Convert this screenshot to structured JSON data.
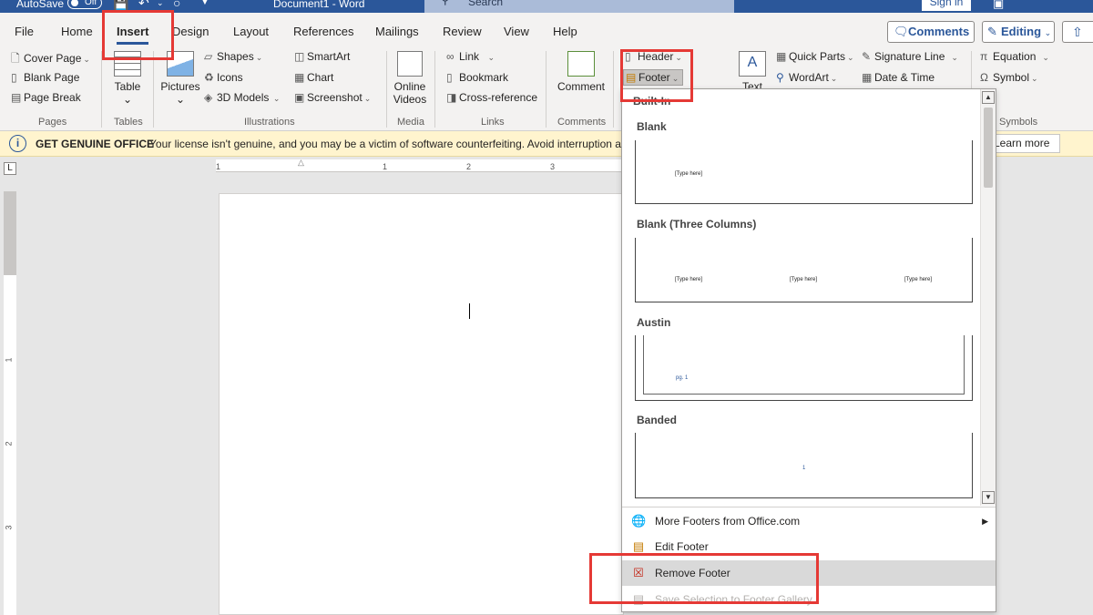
{
  "titlebar": {
    "autosave_label": "AutoSave",
    "autosave_state": "Off",
    "doc_title": "Document1  -  Word",
    "search_placeholder": "Search",
    "signin_label": "Sign in"
  },
  "tabs": [
    "File",
    "Home",
    "Insert",
    "Design",
    "Layout",
    "References",
    "Mailings",
    "Review",
    "View",
    "Help"
  ],
  "active_tab": "Insert",
  "top_buttons": {
    "comments": "Comments",
    "editing": "Editing"
  },
  "ribbon": {
    "pages": {
      "cover_page": "Cover Page",
      "blank_page": "Blank Page",
      "page_break": "Page Break",
      "group": "Pages"
    },
    "tables": {
      "table": "Table",
      "group": "Tables"
    },
    "illustrations": {
      "pictures": "Pictures",
      "shapes": "Shapes",
      "icons": "Icons",
      "models": "3D Models",
      "smartart": "SmartArt",
      "chart": "Chart",
      "screenshot": "Screenshot",
      "group": "Illustrations"
    },
    "media": {
      "online_videos_1": "Online",
      "online_videos_2": "Videos",
      "group": "Media"
    },
    "links": {
      "link": "Link",
      "bookmark": "Bookmark",
      "crossref": "Cross-reference",
      "group": "Links"
    },
    "comments": {
      "comment": "Comment",
      "group": "Comments"
    },
    "header_footer": {
      "header": "Header",
      "footer": "Footer"
    },
    "text": {
      "textbox": "Text",
      "quick_parts": "Quick Parts",
      "wordart": "WordArt",
      "signature_line": "Signature Line",
      "date_time": "Date & Time"
    },
    "symbols": {
      "equation": "Equation",
      "symbol": "Symbol",
      "group": "Symbols"
    }
  },
  "message_bar": {
    "title": "GET GENUINE OFFICE",
    "text": "Your license isn't genuine, and you may be a victim of software counterfeiting. Avoid interruption an",
    "learn_more": "Learn more"
  },
  "ruler": {
    "h_ticks": [
      "1",
      "1",
      "2",
      "3"
    ],
    "v_ticks": [
      "1",
      "1",
      "2",
      "3"
    ]
  },
  "footer_gallery": {
    "section": "Built-In",
    "items": [
      {
        "name": "Blank",
        "placeholders": [
          "[Type here]"
        ]
      },
      {
        "name": "Blank (Three Columns)",
        "placeholders": [
          "[Type here]",
          "[Type here]",
          "[Type here]"
        ]
      },
      {
        "name": "Austin",
        "placeholders": [
          "pg. 1"
        ]
      },
      {
        "name": "Banded",
        "placeholders": [
          "1"
        ]
      }
    ],
    "commands": {
      "more": "More Footers from Office.com",
      "edit": "Edit Footer",
      "remove": "Remove Footer",
      "save": "Save Selection to Footer Gallery"
    }
  },
  "colors": {
    "accent": "#2b579a",
    "callout": "#e53935",
    "message_bar": "#fff4ce"
  }
}
